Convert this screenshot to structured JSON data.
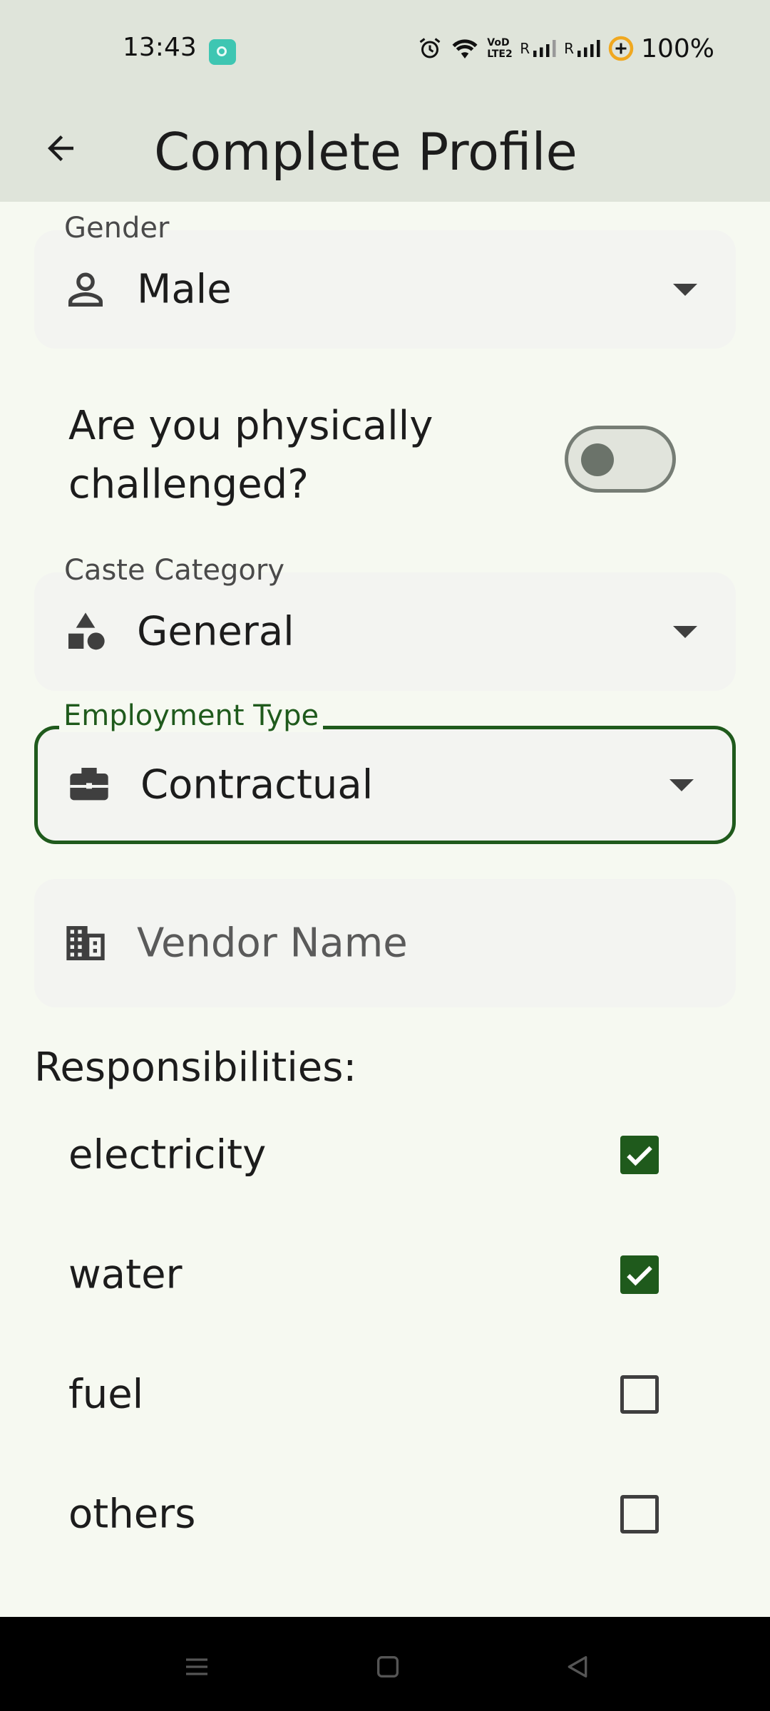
{
  "status_bar": {
    "time": "13:43",
    "network_label_1": "VoD LTE2",
    "roaming_1": "R",
    "roaming_2": "R",
    "battery": "100%"
  },
  "app_bar": {
    "title": "Complete Profile",
    "back_icon": "arrow-back-icon"
  },
  "gender": {
    "label": "Gender",
    "value": "Male",
    "icon": "person-icon"
  },
  "physically_challenged": {
    "label": "Are you physically challenged?",
    "enabled": false
  },
  "caste": {
    "label": "Caste Category",
    "value": "General",
    "icon": "category-shapes-icon"
  },
  "employment": {
    "label": "Employment Type",
    "value": "Contractual",
    "icon": "briefcase-icon"
  },
  "vendor": {
    "placeholder": "Vendor Name",
    "value": "",
    "icon": "building-icon"
  },
  "responsibilities": {
    "title": "Responsibilities:",
    "items": [
      {
        "label": "electricity",
        "checked": true
      },
      {
        "label": "water",
        "checked": true
      },
      {
        "label": "fuel",
        "checked": false
      },
      {
        "label": "others",
        "checked": false
      }
    ]
  },
  "colors": {
    "accent": "#1f5a1c",
    "app_bar": "#dfe4da",
    "background": "#f6f9f1",
    "field": "#f3f4f1"
  }
}
